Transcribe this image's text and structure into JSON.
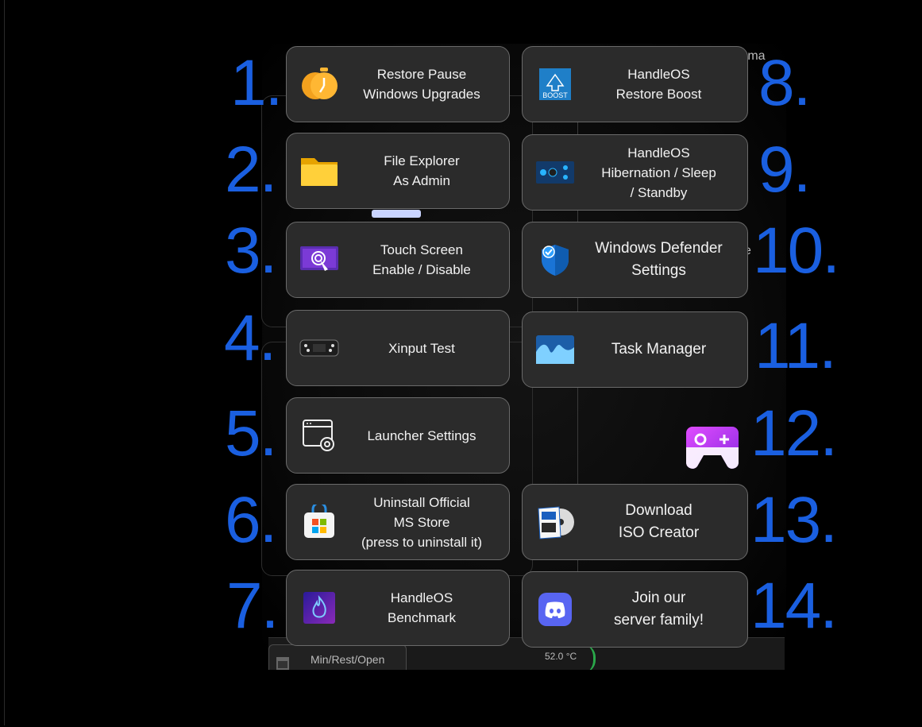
{
  "numbers": [
    "1.",
    "2.",
    "3.",
    "4.",
    "5.",
    "6.",
    "7.",
    "8.",
    "9.",
    "10.",
    "11.",
    "12.",
    "13.",
    "14."
  ],
  "left_column": [
    {
      "lines": [
        "Restore Pause",
        "Windows Upgrades"
      ],
      "icon": "pause-clock-icon"
    },
    {
      "lines": [
        "File Explorer",
        "As Admin"
      ],
      "icon": "folder-icon"
    },
    {
      "lines": [
        "Touch Screen",
        "Enable / Disable"
      ],
      "icon": "touch-screen-icon"
    },
    {
      "lines": [
        "Xinput Test"
      ],
      "icon": "gamepad-device-icon"
    },
    {
      "lines": [
        "Launcher Settings"
      ],
      "icon": "window-settings-icon"
    },
    {
      "lines": [
        "Uninstall Official",
        "MS Store",
        "(press to uninstall it)"
      ],
      "icon": "ms-store-icon"
    },
    {
      "lines": [
        "HandleOS",
        "Benchmark"
      ],
      "icon": "benchmark-flame-icon"
    }
  ],
  "right_column": [
    {
      "lines": [
        "HandleOS",
        "Restore Boost"
      ],
      "icon": "boost-icon"
    },
    {
      "lines": [
        "HandleOS",
        "Hibernation / Sleep",
        "/ Standby"
      ],
      "icon": "power-panel-icon"
    },
    {
      "lines": [
        "Windows Defender",
        "Settings"
      ],
      "icon": "defender-shield-icon"
    },
    {
      "lines": [
        "Task Manager"
      ],
      "icon": "task-manager-icon"
    },
    {
      "lines": [
        "Download",
        "ISO Creator"
      ],
      "icon": "iso-disc-icon"
    },
    {
      "lines": [
        "Join our",
        "server family!"
      ],
      "icon": "discord-icon"
    }
  ],
  "background": {
    "mini_button": "Min/Rest/Open",
    "temperature": "52.0 °C",
    "partial_top": "mma",
    "partial_e1": "e",
    "partial_e2": "le"
  },
  "colors": {
    "number_blue": "#1a5fe0",
    "card_bg": "#2b2b2b",
    "card_border": "#6a6a6a"
  }
}
